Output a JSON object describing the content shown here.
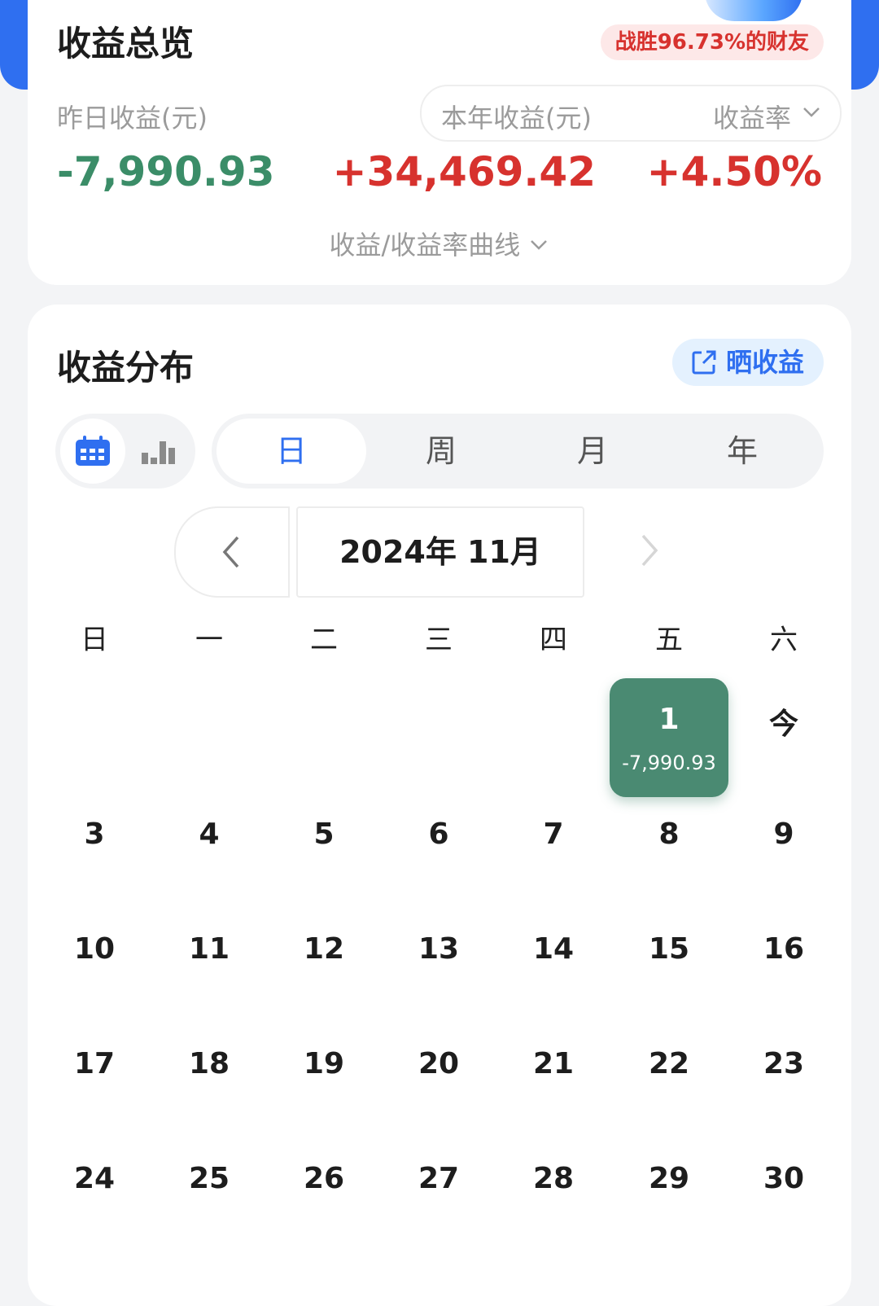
{
  "overview": {
    "title": "收益总览",
    "badge": "战胜96.73%的财友",
    "yesterday_label": "昨日收益(元)",
    "yesterday_value": "-7,990.93",
    "year_label": "本年收益(元)",
    "rate_label": "收益率",
    "year_value": "+34,469.42",
    "rate_value": "+4.50%",
    "curve_link": "收益/收益率曲线"
  },
  "distribution": {
    "title": "收益分布",
    "share_label": "晒收益",
    "tabs": [
      "日",
      "周",
      "月",
      "年"
    ],
    "active_tab": "日",
    "month_label": "2024年 11月",
    "weekdays": [
      "日",
      "一",
      "二",
      "三",
      "四",
      "五",
      "六"
    ],
    "selected_day": {
      "day": "1",
      "amount": "-7,990.93"
    },
    "today_label": "今",
    "days": {
      "w1": [
        "3",
        "4",
        "5",
        "6",
        "7",
        "8",
        "9"
      ],
      "w2": [
        "10",
        "11",
        "12",
        "13",
        "14",
        "15",
        "16"
      ],
      "w3": [
        "17",
        "18",
        "19",
        "20",
        "21",
        "22",
        "23"
      ],
      "w4": [
        "24",
        "25",
        "26",
        "27",
        "28",
        "29",
        "30"
      ]
    }
  },
  "colors": {
    "accent": "#2f6ff0",
    "loss_green": "#3b8d68",
    "gain_red": "#d7322e",
    "selected_day_bg": "#4a8a72"
  }
}
